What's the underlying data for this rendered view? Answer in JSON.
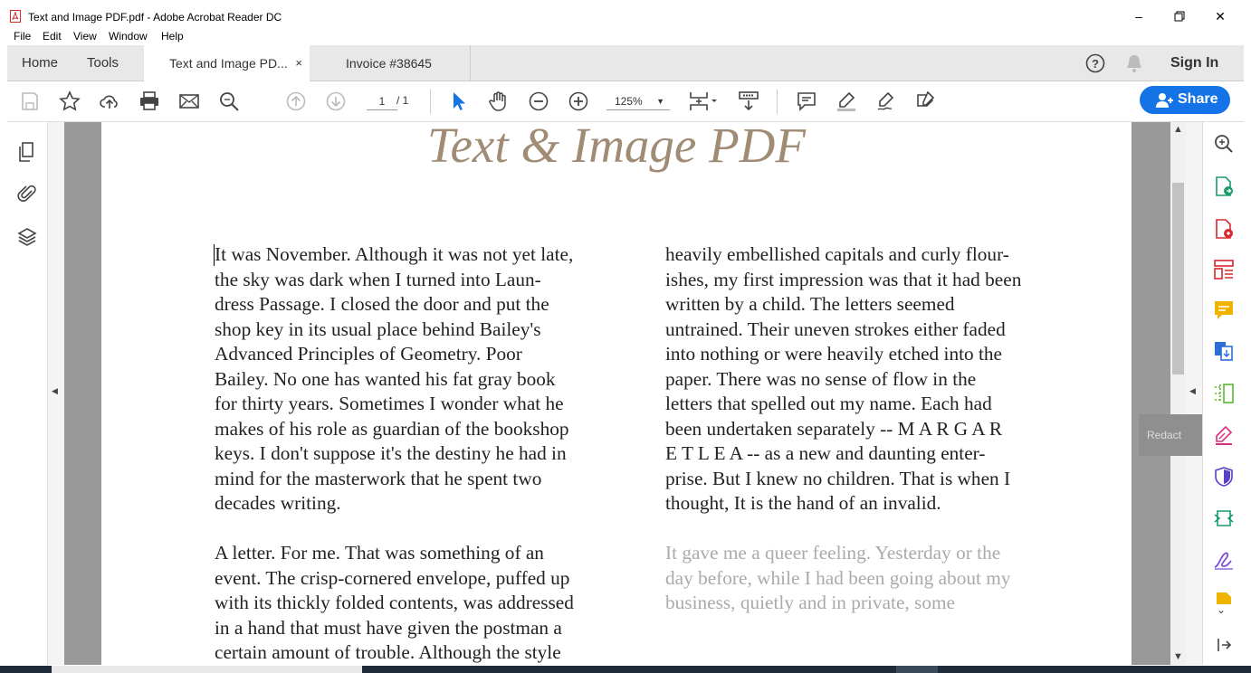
{
  "window": {
    "title": "Text and Image PDF.pdf - Adobe Acrobat Reader DC",
    "minimize_icon": "minimize-icon",
    "maximize_icon": "restore-icon",
    "close_icon": "close-icon"
  },
  "menu": [
    "File",
    "Edit",
    "View",
    "Window",
    "Help"
  ],
  "tabs": {
    "home": "Home",
    "tools": "Tools",
    "documents": [
      {
        "label": "Text and Image PD...",
        "active": true,
        "close": "×"
      },
      {
        "label": "Invoice #38645",
        "active": false
      }
    ],
    "sign_in": "Sign In"
  },
  "toolbar": {
    "page_current": "1",
    "page_total": "/ 1",
    "zoom": "125%",
    "share_label": "Share",
    "accent": "#1473e6"
  },
  "document": {
    "title": "Text & Image PDF",
    "title_color": "#a08c75",
    "left_column": [
      "It was November. Although it was not yet late,\nthe sky was dark when I turned into Laun-\ndress Passage. I closed the door and put the\nshop key in its usual place behind Bailey's\nAdvanced Principles of Geometry. Poor\nBailey. No one has wanted his fat gray book\nfor thirty years. Sometimes I wonder what he\nmakes of his role as guardian of the bookshop\nkeys. I don't suppose it's the destiny he had in\nmind for the masterwork that he spent two\ndecades writing.",
      "A letter. For me. That was something of an\nevent. The crisp-cornered envelope, puffed up\nwith its thickly folded contents, was addressed\nin a hand that must have given the postman a\ncertain amount of trouble. Although the style"
    ],
    "right_column": [
      "heavily embellished capitals and curly flour-\nishes, my first impression was that it had been\nwritten by a child. The letters seemed\nuntrained. Their uneven strokes either faded\ninto nothing or were heavily etched into the\npaper. There was no sense of flow in the\nletters that spelled out my name. Each had\nbeen undertaken separately -- M A R G A R\nE T L E A -- as a new and daunting enter-\nprise. But I knew no children. That is when I\nthought, It is the hand of an invalid.",
      "It gave me a queer feeling. Yesterday or the\nday before, while I had been going about my\nbusiness, quietly and in private, some"
    ]
  },
  "right_panel": {
    "tooltip": "Redact"
  }
}
